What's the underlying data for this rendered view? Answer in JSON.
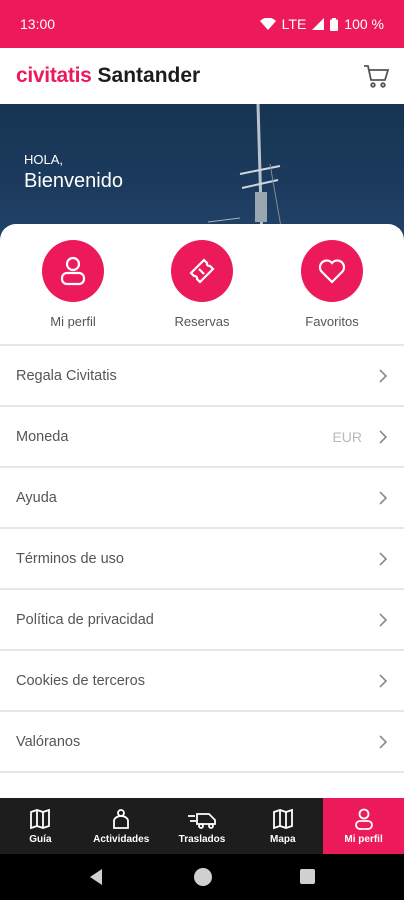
{
  "status": {
    "time": "13:00",
    "network": "LTE",
    "battery": "100 %"
  },
  "header": {
    "logo": "civitatis",
    "city": "Santander",
    "cart_icon": "cart-icon"
  },
  "hero": {
    "greeting": "HOLA,",
    "title": "Bienvenido"
  },
  "quick_actions": [
    {
      "label": "Mi perfil",
      "icon": "user-icon"
    },
    {
      "label": "Reservas",
      "icon": "ticket-icon"
    },
    {
      "label": "Favoritos",
      "icon": "heart-icon"
    }
  ],
  "menu": [
    {
      "label": "Regala Civitatis",
      "value": ""
    },
    {
      "label": "Moneda",
      "value": "EUR"
    },
    {
      "label": "Ayuda",
      "value": ""
    },
    {
      "label": "Términos de uso",
      "value": ""
    },
    {
      "label": "Política de privacidad",
      "value": ""
    },
    {
      "label": "Cookies de terceros",
      "value": ""
    },
    {
      "label": "Valóranos",
      "value": ""
    }
  ],
  "tabs": [
    {
      "label": "Guía",
      "icon": "map-book-icon",
      "active": false
    },
    {
      "label": "Actividades",
      "icon": "activities-icon",
      "active": false
    },
    {
      "label": "Traslados",
      "icon": "transfer-icon",
      "active": false
    },
    {
      "label": "Mapa",
      "icon": "map-icon",
      "active": false
    },
    {
      "label": "Mi perfil",
      "icon": "user-icon",
      "active": true
    }
  ],
  "colors": {
    "brand": "#ec1a5b",
    "tabbar": "#1d1d1d",
    "text_muted": "#555555"
  }
}
